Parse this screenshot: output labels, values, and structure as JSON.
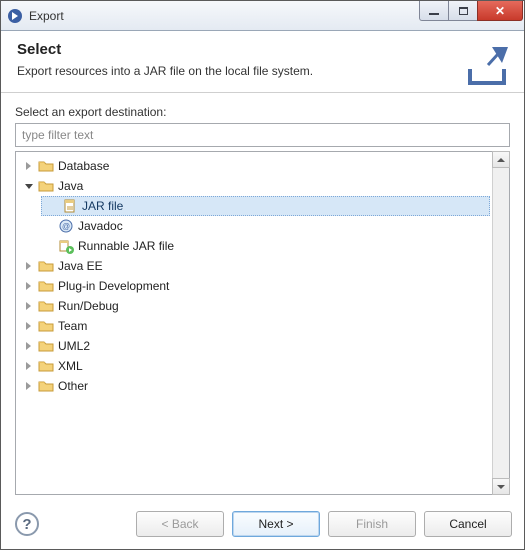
{
  "window": {
    "title": "Export"
  },
  "header": {
    "title": "Select",
    "subtitle": "Export resources into a JAR file on the local file system."
  },
  "content": {
    "label": "Select an export destination:",
    "filter_placeholder": "type filter text"
  },
  "tree": {
    "items": [
      {
        "label": "Database",
        "expanded": false
      },
      {
        "label": "Java",
        "expanded": true,
        "children": [
          {
            "label": "JAR file",
            "icon": "jar",
            "selected": true
          },
          {
            "label": "Javadoc",
            "icon": "javadoc"
          },
          {
            "label": "Runnable JAR file",
            "icon": "runjar"
          }
        ]
      },
      {
        "label": "Java EE",
        "expanded": false
      },
      {
        "label": "Plug-in Development",
        "expanded": false
      },
      {
        "label": "Run/Debug",
        "expanded": false
      },
      {
        "label": "Team",
        "expanded": false
      },
      {
        "label": "UML2",
        "expanded": false
      },
      {
        "label": "XML",
        "expanded": false
      },
      {
        "label": "Other",
        "expanded": false
      }
    ]
  },
  "buttons": {
    "back": "< Back",
    "next": "Next >",
    "finish": "Finish",
    "cancel": "Cancel"
  },
  "help": "?"
}
